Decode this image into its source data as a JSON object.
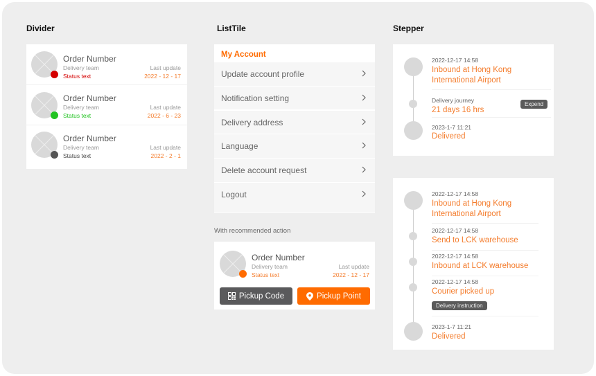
{
  "colors": {
    "accent": "#ff6b00",
    "accent_text": "#f47c2c",
    "status_red": "#d40000",
    "status_green": "#22c322",
    "status_gray": "#555555",
    "status_orange": "#ff6b00",
    "dark_button": "#5a5a5c"
  },
  "divider": {
    "title": "Divider",
    "rows": [
      {
        "title": "Order Number",
        "team": "Delivery team",
        "status": "Status text",
        "status_color": "#d40000",
        "last_update_label": "Last update",
        "date": "2022 - 12 - 17"
      },
      {
        "title": "Order Number",
        "team": "Delivery team",
        "status": "Status text",
        "status_color": "#22c322",
        "last_update_label": "Last update",
        "date": "2022 - 6 - 23"
      },
      {
        "title": "Order Number",
        "team": "Delivery team",
        "status": "Status text",
        "status_color": "#555555",
        "last_update_label": "Last update",
        "date": "2022 - 2 - 1"
      }
    ]
  },
  "listtile": {
    "title": "ListTile",
    "header": "My Account",
    "items": [
      {
        "label": "Update account profile",
        "icon": "chevron-right-icon"
      },
      {
        "label": "Notification setting",
        "icon": "chevron-right-icon"
      },
      {
        "label": "Delivery address",
        "icon": "chevron-right-icon"
      },
      {
        "label": "Language",
        "icon": "chevron-right-icon"
      },
      {
        "label": "Delete account request",
        "icon": "chevron-right-icon"
      },
      {
        "label": "Logout",
        "icon": "chevron-right-icon"
      }
    ],
    "recommended": {
      "label": "With recommended action",
      "title": "Order Number",
      "team": "Delivery team",
      "status": "Status text",
      "status_color": "#ff6b00",
      "last_update_label": "Last update",
      "date": "2022 - 12 - 17",
      "pickup_code_label": "Pickup Code",
      "pickup_code_icon": "qr-code-icon",
      "pickup_point_label": "Pickup Point",
      "pickup_point_icon": "location-pin-icon"
    }
  },
  "stepper": {
    "title": "Stepper",
    "compact": {
      "steps": [
        {
          "time": "2022-12-17 14:58",
          "title_line1": "Inbound at Hong Kong",
          "title_line2": "International Airport"
        },
        {
          "time": "Delivery journey",
          "title": "21 days 16 hrs",
          "action": "Expend"
        },
        {
          "time": "2023-1-7 11:21",
          "title": "Delivered"
        }
      ]
    },
    "expanded": {
      "steps": [
        {
          "time": "2022-12-17 14:58",
          "title_line1": "Inbound at Hong Kong",
          "title_line2": "International Airport"
        },
        {
          "time": "2022-12-17 14:58",
          "title": "Send to LCK warehouse"
        },
        {
          "time": "2022-12-17 14:58",
          "title": "Inbound at LCK warehouse"
        },
        {
          "time": "2022-12-17 14:58",
          "title": "Courier picked up",
          "action": "Delivery instruction"
        },
        {
          "time": "2023-1-7 11:21",
          "title": "Delivered"
        }
      ]
    }
  }
}
